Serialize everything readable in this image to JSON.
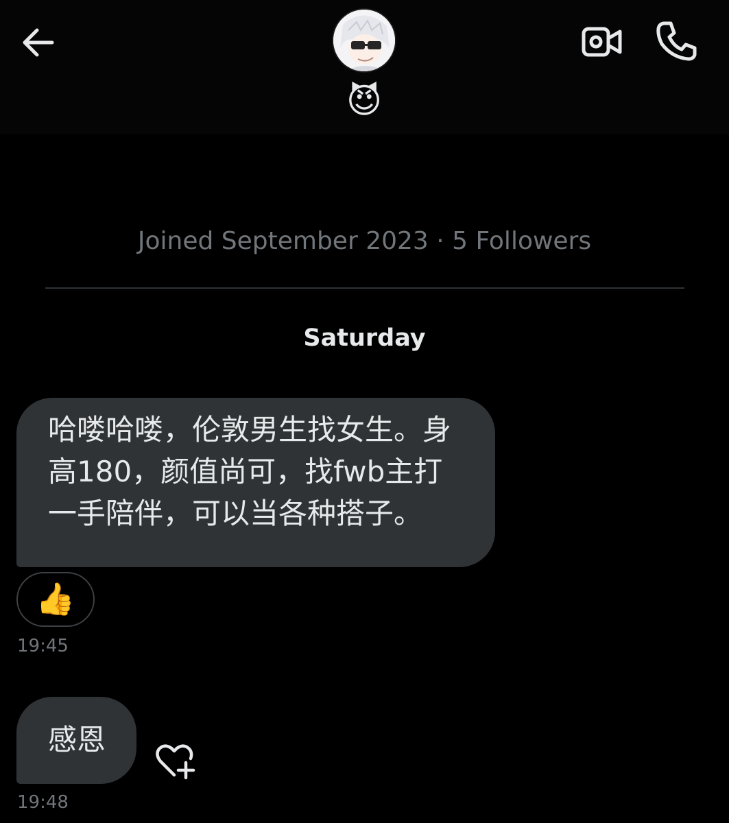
{
  "header": {
    "back_icon": "arrow-left-icon",
    "video_icon": "video-call-icon",
    "phone_icon": "phone-icon",
    "display_name_emoji": "😈"
  },
  "profile": {
    "joined_text": "Joined September 2023 · 5 Followers"
  },
  "conversation": {
    "day_label": "Saturday",
    "messages": [
      {
        "text": "哈喽哈喽，伦敦男生找女生。身\n高180，颜值尚可，找fwb主打\n一手陪伴，可以当各种搭子。",
        "reaction": "👍",
        "time": "19:45"
      },
      {
        "text": "感恩",
        "time": "19:48",
        "action_icon": "heart-plus-icon"
      }
    ]
  },
  "colors": {
    "background": "#000000",
    "bubble": "#2f3336",
    "text": "#e7e9ea",
    "muted": "#71767b"
  }
}
